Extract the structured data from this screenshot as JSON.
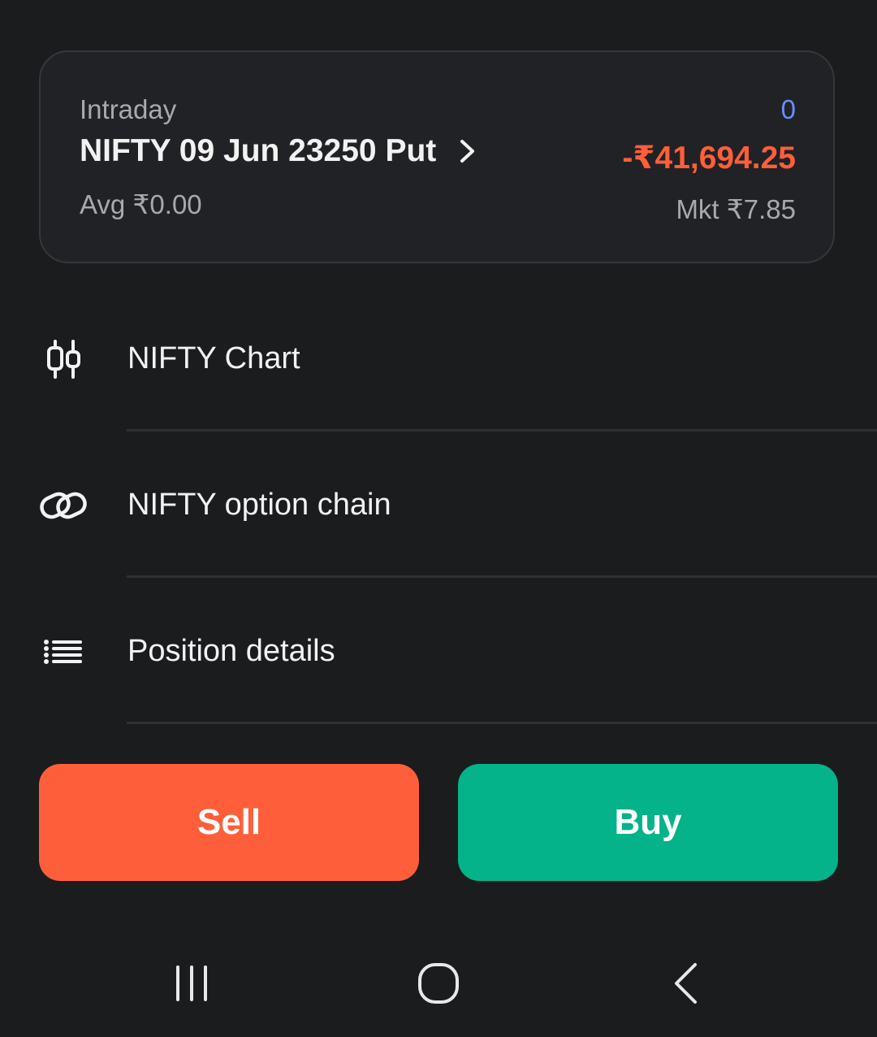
{
  "position": {
    "product": "Intraday",
    "symbol": "NIFTY 09 Jun 23250 Put",
    "avg": "Avg ₹0.00",
    "quantity": "0",
    "pnl": "-₹41,694.25",
    "ltp": "Mkt ₹7.85"
  },
  "menu": {
    "items": [
      {
        "label": "NIFTY Chart",
        "icon": "candlestick-chart-icon"
      },
      {
        "label": "NIFTY option chain",
        "icon": "link-icon"
      },
      {
        "label": "Position details",
        "icon": "list-icon"
      }
    ]
  },
  "actions": {
    "sell_label": "Sell",
    "buy_label": "Buy"
  },
  "navbar": {
    "recent_icon": "recent-apps-icon",
    "home_icon": "home-icon",
    "back_icon": "back-icon"
  },
  "colors": {
    "background": "#1a1c1e",
    "card": "#202225",
    "sell": "#ff5e3a",
    "buy": "#04b389",
    "loss": "#ff5e3a",
    "quantity": "#6c8cff"
  }
}
